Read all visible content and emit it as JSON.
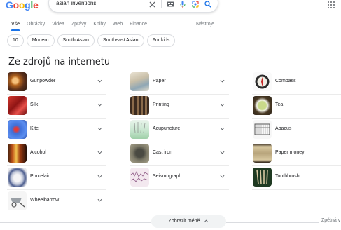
{
  "logo": {
    "text": "Google",
    "letters": [
      "G",
      "o",
      "o",
      "g",
      "l",
      "e"
    ],
    "colors": [
      "#4285f4",
      "#ea4335",
      "#fbbc05",
      "#4285f4",
      "#34a853",
      "#ea4335"
    ]
  },
  "search": {
    "query": "asian inventions"
  },
  "tabs": [
    {
      "label": "Vše",
      "active": true
    },
    {
      "label": "Obrázky",
      "active": false
    },
    {
      "label": "Videa",
      "active": false
    },
    {
      "label": "Zprávy",
      "active": false
    },
    {
      "label": "Knihy",
      "active": false
    },
    {
      "label": "Web",
      "active": false
    },
    {
      "label": "Finance",
      "active": false
    }
  ],
  "tools_label": "Nástroje",
  "chips": [
    "10",
    "Modern",
    "South Asian",
    "Southeast Asian",
    "For kids"
  ],
  "section_title": "Ze zdrojů na internetu",
  "columns": [
    [
      "Gunpowder",
      "Silk",
      "Kite",
      "Alcohol",
      "Porcelain",
      "Wheelbarrow"
    ],
    [
      "Paper",
      "Printing",
      "Acupuncture",
      "Cast iron",
      "Seismograph"
    ],
    [
      "Compass",
      "Tea",
      "Abacus",
      "Paper money",
      "Toothbrush"
    ]
  ],
  "show_less_label": "Zobrazit méně",
  "feedback_label": "Zpětná v",
  "colors": {
    "accent": "#1a73e8",
    "text": "#202124",
    "muted": "#70757a"
  }
}
